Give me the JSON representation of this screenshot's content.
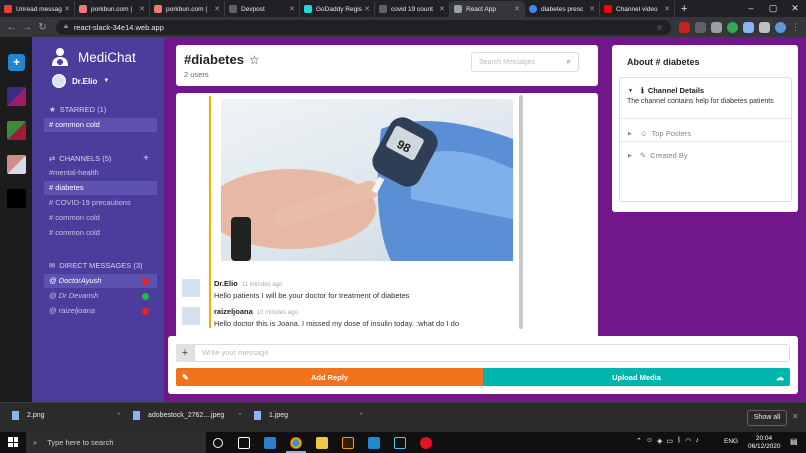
{
  "browser": {
    "tabs": [
      {
        "label": "Unread messag",
        "favicon_color": "#ea4335"
      },
      {
        "label": "porkbun.com |",
        "favicon_color": "#ef7878"
      },
      {
        "label": "porkbun.com |",
        "favicon_color": "#ef7878"
      },
      {
        "label": "Devpost",
        "favicon_color": "#5f6368"
      },
      {
        "label": "GoDaddy Regis",
        "favicon_color": "#1bdbdb"
      },
      {
        "label": "covid 19 count",
        "favicon_color": "#5f6368"
      },
      {
        "label": "React App",
        "favicon_color": "#9aa0a6"
      },
      {
        "label": "diabetes presc",
        "favicon_color": "#4285f4"
      },
      {
        "label": "Channel video",
        "favicon_color": "#ff0000"
      }
    ],
    "active_tab_index": 6,
    "url": "react-slack-34e14.web.app"
  },
  "sidebar": {
    "app_name": "MediChat",
    "user": "Dr.Elio",
    "starred": {
      "title": "STARRED (1)",
      "items": [
        "# common cold"
      ]
    },
    "channels": {
      "title": "CHANNELS (5)",
      "items": [
        "#mental-health",
        "# diabetes",
        "# COVID-19 precautions",
        "# common cold",
        "# common cold"
      ],
      "active_index": 1
    },
    "direct": {
      "title": "DIRECT MESSAGES (3)",
      "items": [
        {
          "label": "@ DoctorAyush",
          "status": "offline",
          "color": "#db2828"
        },
        {
          "label": "@ Dr Devansh",
          "status": "online",
          "color": "#21ba45"
        },
        {
          "label": "@ raizeljoana",
          "status": "offline",
          "color": "#db2828"
        }
      ],
      "active_index": 0
    }
  },
  "channel": {
    "name": "#diabetes",
    "users": "2 users",
    "search_placeholder": "Search Messages"
  },
  "messages": [
    {
      "author": "Dr.Elio",
      "time": "11 minutes ago",
      "text": "Hello patients I will be your doctor for treatment of diabetes"
    },
    {
      "author": "raizeljoana",
      "time": "10 minutes ago",
      "text": "Hello doctor this is Joana. I missed my dose of insulin today. :what do I do"
    }
  ],
  "glucometer_reading": "98",
  "composer": {
    "placeholder": "Write your message",
    "reply_label": "Add Reply",
    "upload_label": "Upload Media"
  },
  "about": {
    "title": "About # diabetes",
    "details_label": "Channel Details",
    "details_text": "The channel contains help for diabetes patients",
    "top_posters_label": "Top Posters",
    "created_by_label": "Created By"
  },
  "downloads": [
    {
      "name": "2.png"
    },
    {
      "name": "adobestock_2762....jpeg"
    },
    {
      "name": "1.jpeg"
    }
  ],
  "downloads_show_all": "Show all",
  "taskbar": {
    "search_placeholder": "Type here to search",
    "lang": "ENG",
    "time": "20:04",
    "date": "06/12/2020"
  },
  "colors": {
    "sidebar": "#4c3c9c",
    "main": "#72178a",
    "reply": "#f2711c",
    "upload": "#00b5ad"
  }
}
